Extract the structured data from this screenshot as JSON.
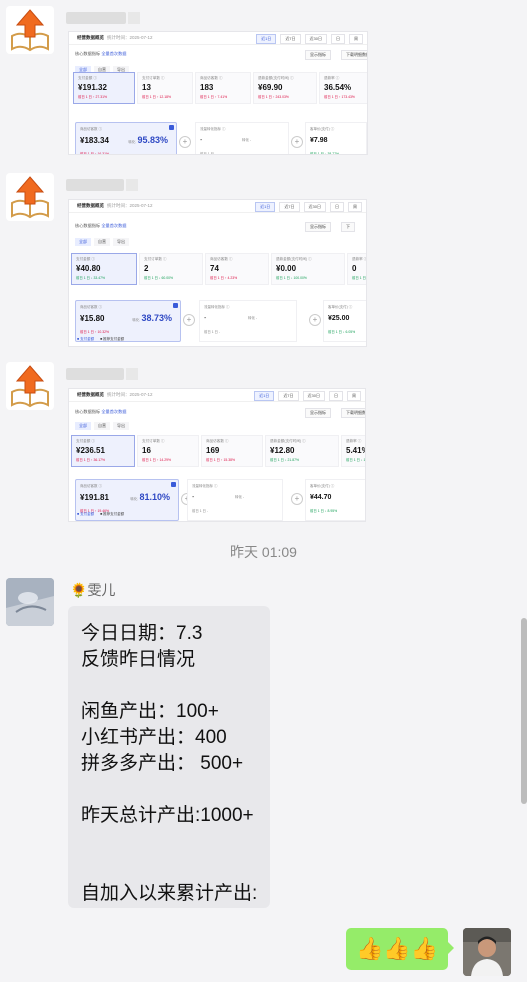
{
  "screens": [
    {
      "title": "经营数据概览",
      "date": "统计时间：2025-07-12",
      "tabs": [
        "近1日",
        "近7日",
        "近30日",
        "日",
        "周"
      ],
      "shop_label": "核心数据指标",
      "shop_link": "全量首次数据",
      "right_btns": [
        "显示指标",
        "下载明细数据"
      ],
      "mtabs": [
        "全部",
        "自营",
        "导出"
      ],
      "metrics": [
        {
          "label": "支付金额 ⓘ",
          "value": "¥191.32",
          "change": "前日 1 日 ↑ 27.31%",
          "tone": "up"
        },
        {
          "label": "支付订单数 ⓘ",
          "value": "13",
          "change": "前日 1 日 ↑ 12.18%",
          "tone": "up"
        },
        {
          "label": "商品访客数 ⓘ",
          "value": "183",
          "change": "前日 1 日 ↑ 7.41%",
          "tone": "up"
        },
        {
          "label": "退款金额(支付时间) ⓘ",
          "value": "¥69.90",
          "change": "前日 1 日 ↑ 243.03%",
          "tone": "up"
        },
        {
          "label": "退款率 ⓘ",
          "value": "36.54%",
          "change": "前日 1 日 ↑ 173.43%",
          "tone": "up"
        }
      ],
      "funnel": {
        "label": "商品访客数 ⓘ",
        "value": "¥183.34",
        "change": "前日 1 日 ↑ 16.31%",
        "pct_label": "转化",
        "pct": "95.83%"
      },
      "empty": {
        "label": "流量转化指标 ⓘ",
        "value": "-",
        "change": "前日 1 日 -",
        "mid": "转化 -"
      },
      "right": {
        "label": "客单价(支付) ⓘ",
        "value": "¥7.98",
        "change": "前日 1 日 ↓ 38.77%"
      },
      "legend": []
    },
    {
      "title": "经营数据概览",
      "date": "统计时间：2025-07-12",
      "tabs": [
        "近1日",
        "近7日",
        "近30日",
        "日",
        "周"
      ],
      "shop_label": "核心数据指标",
      "shop_link": "全量首次数据",
      "right_btns": [
        "显示指标",
        "下"
      ],
      "mtabs": [
        "全部",
        "自营",
        "导出"
      ],
      "metrics": [
        {
          "label": "支付金额 ⓘ",
          "value": "¥40.80",
          "change": "前日 1 日 ↓ 33.47%",
          "tone": "down"
        },
        {
          "label": "支付订单数 ⓘ",
          "value": "2",
          "change": "前日 1 日 ↓ 60.00%",
          "tone": "down"
        },
        {
          "label": "商品访客数 ⓘ",
          "value": "74",
          "change": "前日 1 日 ↑ 4.23%",
          "tone": "up"
        },
        {
          "label": "退款金额(支付时间) ⓘ",
          "value": "¥0.00",
          "change": "前日 1 日 ↓ 100.00%",
          "tone": "down"
        },
        {
          "label": "退款率 ⓘ",
          "value": "0",
          "change": "前日 1 日",
          "tone": "down"
        }
      ],
      "funnel": {
        "label": "商品访客数 ⓘ",
        "value": "¥15.80",
        "change": "前日 1 日 ↑ 10.32%",
        "pct_label": "转化",
        "pct": "38.73%"
      },
      "empty": {
        "label": "流量转化指标 ⓘ",
        "value": "-",
        "change": "前日 1 日 -",
        "mid": "转化 -"
      },
      "right": {
        "label": "客单价(支付) ⓘ",
        "value": "¥25.00",
        "change": "前日 1 日 ↓ 6.05%"
      },
      "legend": [
        "■ 支付金额",
        "■ 推荐支付金额"
      ]
    },
    {
      "title": "经营数据概览",
      "date": "统计时间：2025-07-12",
      "tabs": [
        "近1日",
        "近7日",
        "近30日",
        "日",
        "周"
      ],
      "shop_label": "核心数据指标",
      "shop_link": "全量首次数据",
      "right_btns": [
        "显示指标",
        "下载明细数据"
      ],
      "mtabs": [
        "全部",
        "自营",
        "导出"
      ],
      "metrics": [
        {
          "label": "支付金额 ⓘ",
          "value": "¥236.51",
          "change": "前日 1 日 ↑ 36.17%",
          "tone": "up"
        },
        {
          "label": "支付订单数 ⓘ",
          "value": "16",
          "change": "前日 1 日 ↑ 14.29%",
          "tone": "up"
        },
        {
          "label": "商品访客数 ⓘ",
          "value": "169",
          "change": "前日 1 日 ↑ 15.38%",
          "tone": "up"
        },
        {
          "label": "退款金额(支付时间) ⓘ",
          "value": "¥12.80",
          "change": "前日 1 日 ↓ 21.87%",
          "tone": "down"
        },
        {
          "label": "退款率 ⓘ",
          "value": "5.41%",
          "change": "前日 1 日 ↓ 12.44%",
          "tone": "down"
        }
      ],
      "funnel": {
        "label": "商品访客数 ⓘ",
        "value": "¥191.81",
        "change": "前日 1 日 ↑ 19.46%",
        "pct_label": "转化",
        "pct": "81.10%"
      },
      "empty": {
        "label": "流量转化指标 ⓘ",
        "value": "-",
        "change": "前日 1 日 -",
        "mid": "转化 -"
      },
      "right": {
        "label": "客单价(支付) ⓘ",
        "value": "¥44.70",
        "change": "前日 1 日 ↓ 8.95%"
      },
      "legend": [
        "■ 支付金额",
        "■ 推荐支付金额"
      ]
    }
  ],
  "timestamp": "昨天 01:09",
  "sender": {
    "name": "雯儿",
    "flower": "🌻"
  },
  "message_lines": [
    "今日日期：7.3",
    "反馈昨日情况",
    "",
    "闲鱼产出：100+",
    "小红书产出：400",
    "拼多多产出：  500+",
    "",
    "昨天总计产出:1000+",
    "",
    "",
    "自加入以来累计产出:"
  ],
  "reply": "👍👍👍",
  "colors": {
    "bubble_self": "#95ec69",
    "bubble_other": "#e8e8eb",
    "accent": "#3a5bd9"
  }
}
